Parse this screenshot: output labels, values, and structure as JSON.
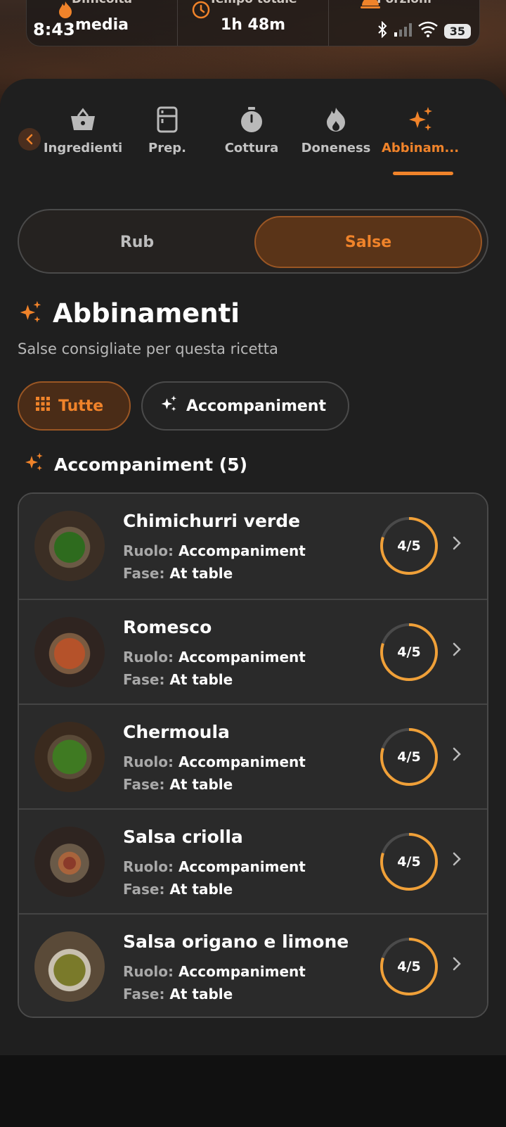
{
  "status_bar": {
    "time": "8:43",
    "battery": "35"
  },
  "stats": [
    {
      "label": "Difficoltà",
      "value": "media",
      "icon": "flame-icon"
    },
    {
      "label": "Tempo totale",
      "value": "1h 48m",
      "icon": "clock-icon"
    },
    {
      "label": "Porzioni",
      "value": "",
      "icon": "cloche-icon"
    }
  ],
  "tabs": [
    {
      "label": "Ingredienti",
      "icon": "basket-icon"
    },
    {
      "label": "Prep.",
      "icon": "fridge-icon"
    },
    {
      "label": "Cottura",
      "icon": "timer-icon"
    },
    {
      "label": "Doneness",
      "icon": "flame-icon"
    },
    {
      "label": "Abbinam...",
      "icon": "sparkles-icon",
      "active": true
    }
  ],
  "segment": {
    "rub": "Rub",
    "salse": "Salse",
    "selected": "Salse"
  },
  "section": {
    "title": "Abbinamenti",
    "subtitle": "Salse consigliate per questa ricetta"
  },
  "chips": {
    "all": "Tutte",
    "accompaniment": "Accompaniment"
  },
  "group": {
    "title": "Accompaniment (5)"
  },
  "labels": {
    "role": "Ruolo:",
    "phase": "Fase:"
  },
  "items": [
    {
      "name": "Chimichurri verde",
      "role": "Accompaniment",
      "phase": "At table",
      "score": "4/5",
      "score_value": 0.8
    },
    {
      "name": "Romesco",
      "role": "Accompaniment",
      "phase": "At table",
      "score": "4/5",
      "score_value": 0.8
    },
    {
      "name": "Chermoula",
      "role": "Accompaniment",
      "phase": "At table",
      "score": "4/5",
      "score_value": 0.8
    },
    {
      "name": "Salsa criolla",
      "role": "Accompaniment",
      "phase": "At table",
      "score": "4/5",
      "score_value": 0.8
    },
    {
      "name": "Salsa origano e limone",
      "role": "Accompaniment",
      "phase": "At table",
      "score": "4/5",
      "score_value": 0.8
    }
  ],
  "colors": {
    "accent": "#f0832a",
    "sheet": "#1f1f1f",
    "card": "#2a2a2a"
  }
}
